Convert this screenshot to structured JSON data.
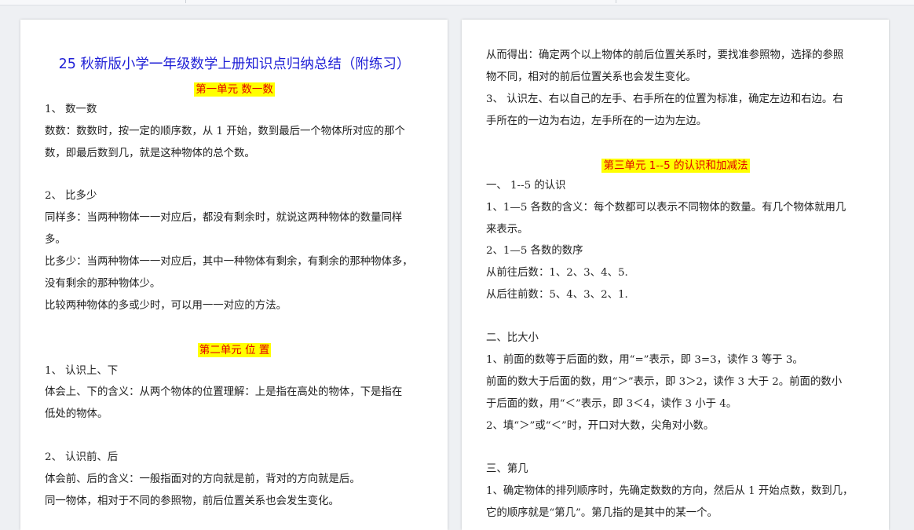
{
  "left_page": {
    "title": "25 秋新版小学一年级数学上册知识点归纳总结（附练习）",
    "unit1_heading": "第一单元  数一数",
    "unit1_lines": [
      "1、  数一数",
      "数数：数数时，按一定的顺序数，从 1 开始，数到最后一个物体所对应的那个",
      "数，即最后数到几，就是这种物体的总个数。",
      "2、  比多少",
      "同样多：当两种物体一一对应后，都没有剩余时，就说这两种物体的数量同样",
      "多。",
      "比多少：当两种物体一一对应后，其中一种物体有剩余，有剩余的那种物体多，",
      "没有剩余的那种物体少。",
      "比较两种物体的多或少时，可以用一一对应的方法。"
    ],
    "unit2_heading": "第二单元  位  置",
    "unit2_lines": [
      "1、  认识上、下",
      "体会上、下的含义：从两个物体的位置理解：上是指在高处的物体，下是指在",
      "低处的物体。",
      "2、  认识前、后",
      "体会前、后的含义：一般指面对的方向就是前，背对的方向就是后。",
      "同一物体，相对于不同的参照物，前后位置关系也会发生变化。"
    ]
  },
  "right_page": {
    "cont_lines": [
      "从而得出：确定两个以上物体的前后位置关系时，要找准参照物，选择的参照",
      "物不同，相对的前后位置关系也会发生变化。",
      "3、  认识左、右以自己的左手、右手所在的位置为标准，确定左边和右边。右",
      "手所在的一边为右边，左手所在的一边为左边。"
    ],
    "unit3_heading": "第三单元  1--5 的认识和加减法",
    "unit3_lines": [
      "一、  1--5 的认识",
      "1、1—5 各数的含义：每个数都可以表示不同物体的数量。有几个物体就用几",
      "来表示。",
      "2、1—5 各数的数序",
      "从前往后数：1、2、3、4、5.",
      "从后往前数：5、4、3、2、1.",
      "二、比大小",
      "1、前面的数等于后面的数，用“=”表示，即 3=3，读作 3 等于 3。",
      "前面的数大于后面的数，用“＞”表示，即 3＞2，读作 3 大于 2。前面的数小",
      "于后面的数，用“＜”表示，即 3＜4，读作 3 小于 4。",
      "2、填“＞”或“＜”时，开口对大数，尖角对小数。",
      "三、第几",
      "1、确定物体的排列顺序时，先确定数数的方向，然后从 1 开始点数，数到几，",
      "它的顺序就是“第几”。第几指的是其中的某一个。"
    ]
  }
}
